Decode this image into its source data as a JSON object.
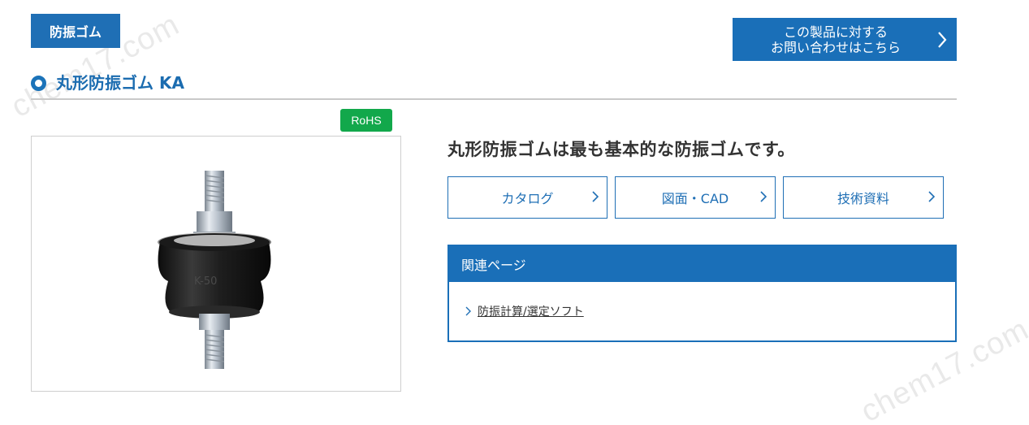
{
  "watermark": "chem17.com",
  "category_tag": "防振ゴム",
  "inquiry_button": {
    "line1": "この製品に対する",
    "line2": "お問い合わせはこちら",
    "icon": "chevron-right-icon"
  },
  "product": {
    "title": "丸形防振ゴム KA",
    "badge": "RoHS",
    "image_marking": "K-50",
    "lead": "丸形防振ゴムは最も基本的な防振ゴムです。"
  },
  "doc_buttons": [
    {
      "label": "カタログ",
      "icon": "chevron-right-icon"
    },
    {
      "label": "図面・CAD",
      "icon": "chevron-right-icon"
    },
    {
      "label": "技術資料",
      "icon": "chevron-right-icon"
    }
  ],
  "related": {
    "header": "関連ページ",
    "links": [
      {
        "label": "防振計算/選定ソフト",
        "icon": "chevron-right-icon"
      }
    ]
  },
  "colors": {
    "brand_blue": "#1a6fb8",
    "rohs_green": "#12a84b",
    "rule_gray": "#c9c9c9"
  }
}
